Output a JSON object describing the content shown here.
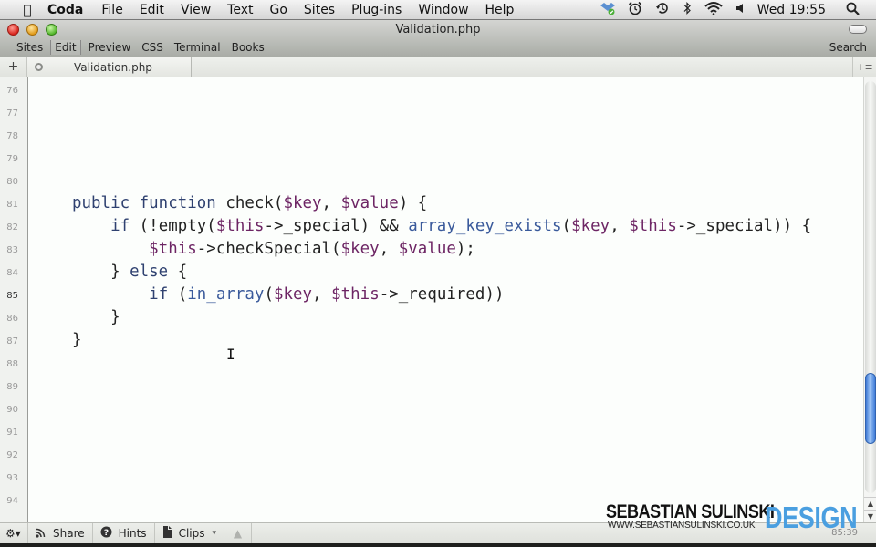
{
  "menubar": {
    "app_name": "Coda",
    "menus": [
      "File",
      "Edit",
      "View",
      "Text",
      "Go",
      "Sites",
      "Plug-ins",
      "Window",
      "Help"
    ],
    "status_icons": [
      "dropbox-icon",
      "alarm-clock-icon",
      "time-machine-icon",
      "bluetooth-icon",
      "wifi-icon",
      "volume-icon"
    ],
    "clock": "Wed 19:55"
  },
  "window": {
    "title": "Validation.php",
    "nav_tabs": [
      {
        "label": "Sites",
        "active": false
      },
      {
        "label": "Edit",
        "active": true
      },
      {
        "label": "Preview",
        "active": false
      },
      {
        "label": "CSS",
        "active": false
      },
      {
        "label": "Terminal",
        "active": false
      },
      {
        "label": "Books",
        "active": false
      }
    ],
    "search_label": "Search"
  },
  "tabbar": {
    "add_label": "+",
    "open_tab": "Validation.php",
    "menu_label": "+≡"
  },
  "editor": {
    "current_line": 85,
    "line_numbers": [
      "76",
      "77",
      "78",
      "79",
      "80",
      "81",
      "82",
      "83",
      "84",
      "85",
      "86",
      "87",
      "88",
      "89",
      "90",
      "91",
      "92",
      "93",
      "94"
    ],
    "code_lines": [
      {
        "line": 81,
        "tokens": [
          [
            "kw",
            "public function "
          ],
          [
            "pl",
            "check("
          ],
          [
            "var",
            "$key"
          ],
          [
            "pl",
            ", "
          ],
          [
            "var",
            "$value"
          ],
          [
            "pl",
            ") {"
          ]
        ]
      },
      {
        "line": 82,
        "tokens": [
          [
            "pl",
            "    "
          ],
          [
            "kw",
            "if"
          ],
          [
            "pl",
            " (!empty("
          ],
          [
            "var",
            "$this"
          ],
          [
            "pl",
            "->_special) && "
          ],
          [
            "fn",
            "array_key_exists"
          ],
          [
            "pl",
            "("
          ],
          [
            "var",
            "$key"
          ],
          [
            "pl",
            ", "
          ],
          [
            "var",
            "$this"
          ],
          [
            "pl",
            "->_special)) {"
          ]
        ]
      },
      {
        "line": 83,
        "tokens": [
          [
            "pl",
            "        "
          ],
          [
            "var",
            "$this"
          ],
          [
            "pl",
            "->checkSpecial("
          ],
          [
            "var",
            "$key"
          ],
          [
            "pl",
            ", "
          ],
          [
            "var",
            "$value"
          ],
          [
            "pl",
            ");"
          ]
        ]
      },
      {
        "line": 84,
        "tokens": [
          [
            "pl",
            "    } "
          ],
          [
            "kw",
            "else"
          ],
          [
            "pl",
            " {"
          ]
        ]
      },
      {
        "line": 85,
        "tokens": [
          [
            "pl",
            "        "
          ],
          [
            "kw",
            "if"
          ],
          [
            "pl",
            " ("
          ],
          [
            "fn",
            "in_array"
          ],
          [
            "pl",
            "("
          ],
          [
            "var",
            "$key"
          ],
          [
            "pl",
            ", "
          ],
          [
            "var",
            "$this"
          ],
          [
            "pl",
            "->_required))"
          ]
        ]
      },
      {
        "line": 86,
        "tokens": [
          [
            "pl",
            "    }"
          ]
        ]
      },
      {
        "line": 87,
        "tokens": [
          [
            "pl",
            "}"
          ]
        ]
      }
    ],
    "scroll_position": 0.78
  },
  "bottombar": {
    "share_label": "Share",
    "hints_label": "Hints",
    "clips_label": "Clips",
    "cursor_position": "85:39"
  },
  "watermark": {
    "name": "SEBASTIAN SULINSKI",
    "url": "WWW.SEBASTIANSULINSKI.CO.UK",
    "design": "DESIGN"
  },
  "colors": {
    "keyword": "#2f4170",
    "variable": "#6d2564",
    "function": "#3a5a9b",
    "scroll_thumb": "#4a86dc",
    "watermark_accent": "#4a9fe0"
  }
}
